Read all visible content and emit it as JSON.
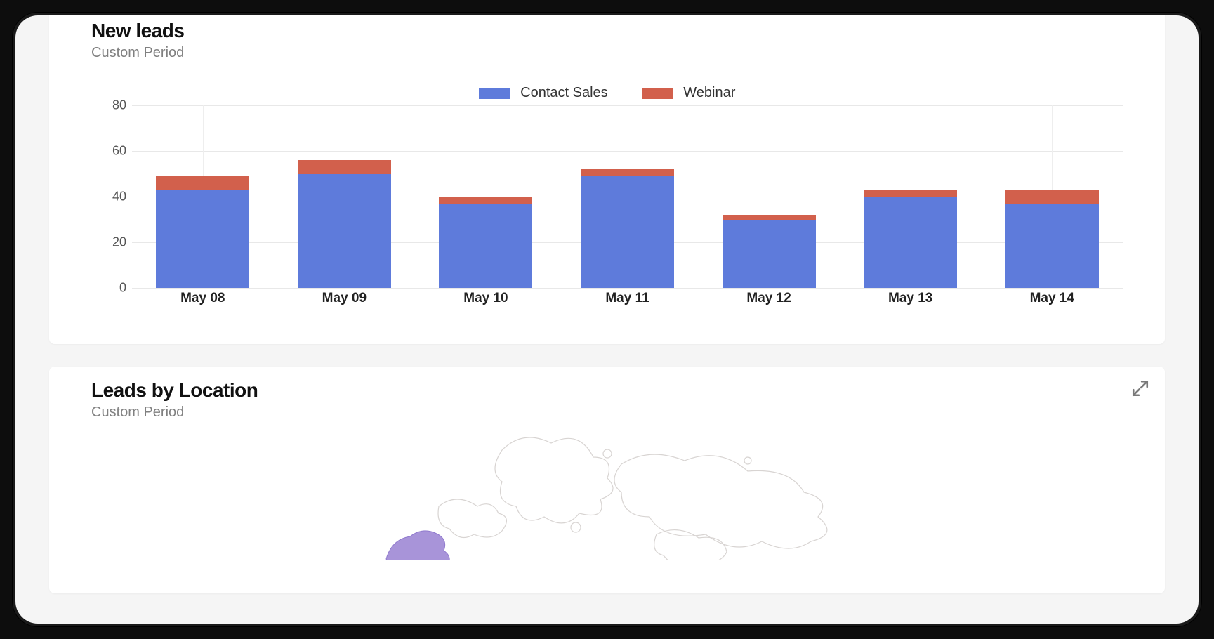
{
  "cards": {
    "new_leads": {
      "title": "New leads",
      "subtitle": "Custom Period"
    },
    "by_location": {
      "title": "Leads by Location",
      "subtitle": "Custom Period"
    }
  },
  "legend": {
    "series1": "Contact Sales",
    "series2": "Webinar"
  },
  "colors": {
    "contact_sales": "#5E7BDB",
    "webinar": "#D2604C",
    "map_highlight": "#A48FD8",
    "map_outline": "#D6D2D0"
  },
  "chart_data": {
    "type": "bar",
    "stacked": true,
    "title": "New leads",
    "xlabel": "",
    "ylabel": "",
    "categories": [
      "May 08",
      "May 09",
      "May 10",
      "May 11",
      "May 12",
      "May 13",
      "May 14"
    ],
    "series": [
      {
        "name": "Contact Sales",
        "color": "#5E7BDB",
        "values": [
          43,
          50,
          37,
          49,
          30,
          40,
          37
        ]
      },
      {
        "name": "Webinar",
        "color": "#D2604C",
        "values": [
          6,
          6,
          3,
          3,
          2,
          3,
          6
        ]
      }
    ],
    "ylim": [
      0,
      80
    ],
    "yticks": [
      0,
      20,
      40,
      60,
      80
    ],
    "grid": true,
    "legend_position": "top"
  }
}
